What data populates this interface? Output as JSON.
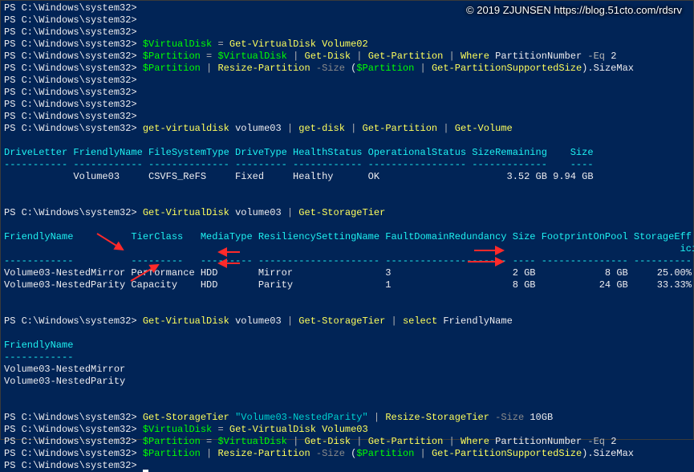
{
  "watermark": "© 2019 ZJUNSEN https://blog.51cto.com/rdsrv",
  "prompt": "PS C:\\Windows\\system32>",
  "blank_prompt": "PS C:\\Windows\\system32>",
  "cmd_vd02": {
    "var": "$VirtualDisk",
    "assign": " = ",
    "rest": "Get-VirtualDisk Volume02"
  },
  "cmd_part02": {
    "var": "$Partition",
    "assign": " = ",
    "vd": "$VirtualDisk",
    "p1": " | ",
    "gd": "Get-Disk",
    "p2": " | ",
    "gp": "Get-Partition",
    "p3": " | ",
    "wh": "Where",
    "tail": " PartitionNumber ",
    "eq": "-Eq",
    "two": " 2"
  },
  "cmd_resize02": {
    "var": "$Partition",
    "p1": " | ",
    "rp": "Resize-Partition",
    "sz": " -Size",
    "op": " (",
    "v2": "$Partition",
    "p2": " | ",
    "gps": "Get-PartitionSupportedSize",
    "cp": ")",
    "tail": ".SizeMax"
  },
  "cmd_getvol": {
    "c1": "get-virtualdisk",
    "arg": " volume03 ",
    "p": "| ",
    "c2": "get-disk",
    "p2": " | ",
    "c3": "Get-Partition",
    "p3": " | ",
    "c4": "Get-Volume"
  },
  "table1": {
    "hdr": "DriveLetter FriendlyName FileSystemType DriveType HealthStatus OperationalStatus SizeRemaining    Size",
    "sep": "----------- ------------ -------------- --------- ------------ ----------------- -------------    ----",
    "row": "            Volume03     CSVFS_ReFS     Fixed     Healthy      OK                      3.52 GB 9.94 GB"
  },
  "cmd_tier": {
    "c1": "Get-VirtualDisk",
    "arg": " volume03 ",
    "p": "| ",
    "c2": "Get-StorageTier"
  },
  "table2": {
    "hdr": "FriendlyName          TierClass   MediaType ResiliencySettingName FaultDomainRedundancy Size FootprintOnPool StorageEff\n                                                                                                                     iciency",
    "sep": "------------          ---------   --------- --------------------- --------------------- ---- --------------- ----------",
    "row1": "Volume03-NestedMirror Performance HDD       Mirror                3                     2 GB            8 GB     25.00%",
    "row2": "Volume03-NestedParity Capacity    HDD       Parity                1                     8 GB           24 GB     33.33%"
  },
  "cmd_sel": {
    "c1": "Get-VirtualDisk",
    "arg": " volume03 ",
    "p": "| ",
    "c2": "Get-StorageTier",
    "p2": " | ",
    "c3": "select",
    "tail": " FriendlyName"
  },
  "table3": {
    "hdr": "FriendlyName",
    "sep": "------------",
    "r1": "Volume03-NestedMirror",
    "r2": "Volume03-NestedParity"
  },
  "cmd_resizeTier": {
    "c1": "Get-StorageTier",
    "q": " \"Volume03-NestedParity\"",
    "p": " | ",
    "c2": "Resize-StorageTier",
    "sz": " -Size",
    "arg": " 10GB"
  },
  "cmd_vd03": {
    "var": "$VirtualDisk",
    "assign": " = ",
    "rest": "Get-VirtualDisk Volume03"
  }
}
